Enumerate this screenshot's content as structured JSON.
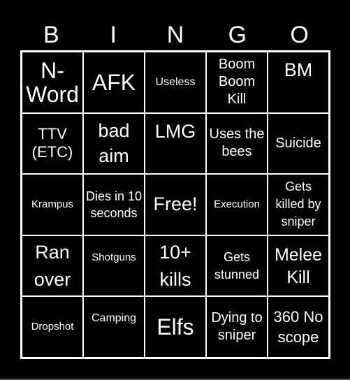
{
  "header": {
    "letters": [
      "B",
      "I",
      "N",
      "G",
      "O"
    ]
  },
  "card": {
    "rows": [
      [
        "N-Word",
        "AFK",
        "Useless",
        "Boom Boom Kill",
        "BM"
      ],
      [
        "TTV (ETC)",
        "bad aim",
        "LMG",
        "Uses the bees",
        "Suicide"
      ],
      [
        "Krampus",
        "Dies in 10 seconds",
        "Free!",
        "Execution",
        "Gets killed by sniper"
      ],
      [
        "Ran over",
        "Shotguns",
        "10+ kills",
        "Gets stunned",
        "Melee Kill"
      ],
      [
        "Dropshot",
        "Camping",
        "Elfs",
        "Dying to sniper",
        "360 No scope"
      ]
    ],
    "free_space": "Free!"
  },
  "colors": {
    "background": "#000000",
    "text": "#ffffff",
    "grid_lines": "#ffffff"
  }
}
